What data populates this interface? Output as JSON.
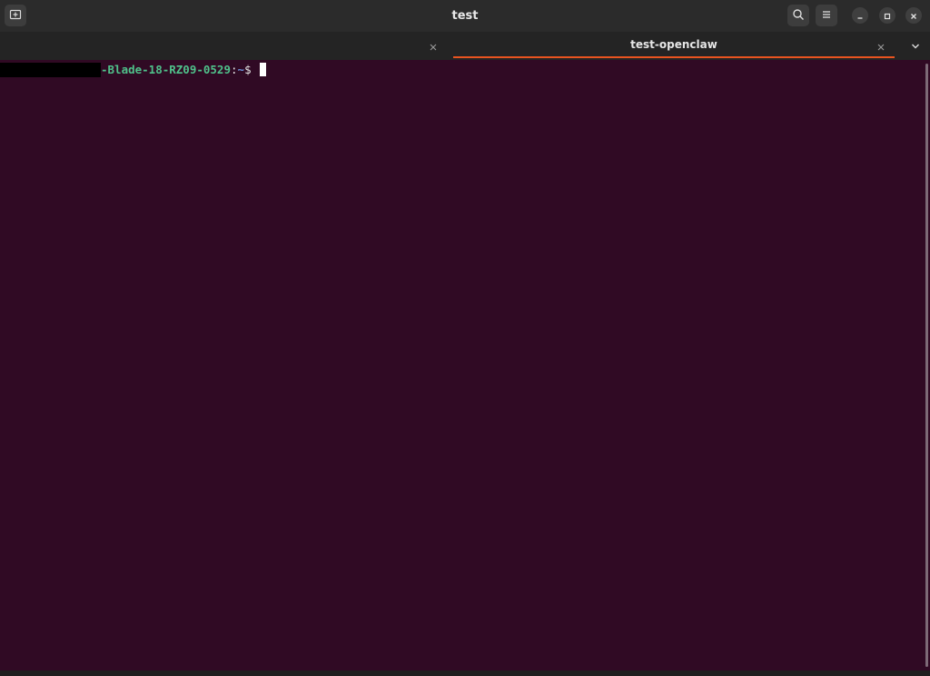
{
  "window": {
    "title": "test"
  },
  "header": {
    "new_tab_icon": "new-tab-icon",
    "search_icon": "search-icon",
    "menu_icon": "hamburger-menu-icon",
    "minimize_icon": "minimize-icon",
    "maximize_icon": "maximize-icon",
    "close_icon": "close-icon"
  },
  "tabs": [
    {
      "label": "",
      "active": false
    },
    {
      "label": "test-openclaw",
      "active": true
    }
  ],
  "tab_overflow_icon": "chevron-down-icon",
  "terminal": {
    "host": "-Blade-18-RZ09-0529",
    "separator": ":",
    "path": "~",
    "symbol": "$ "
  },
  "colors": {
    "terminal_bg": "#300a24",
    "accent": "#e95420",
    "host_green": "#4fc18a",
    "path_blue": "#6b8fd6"
  }
}
